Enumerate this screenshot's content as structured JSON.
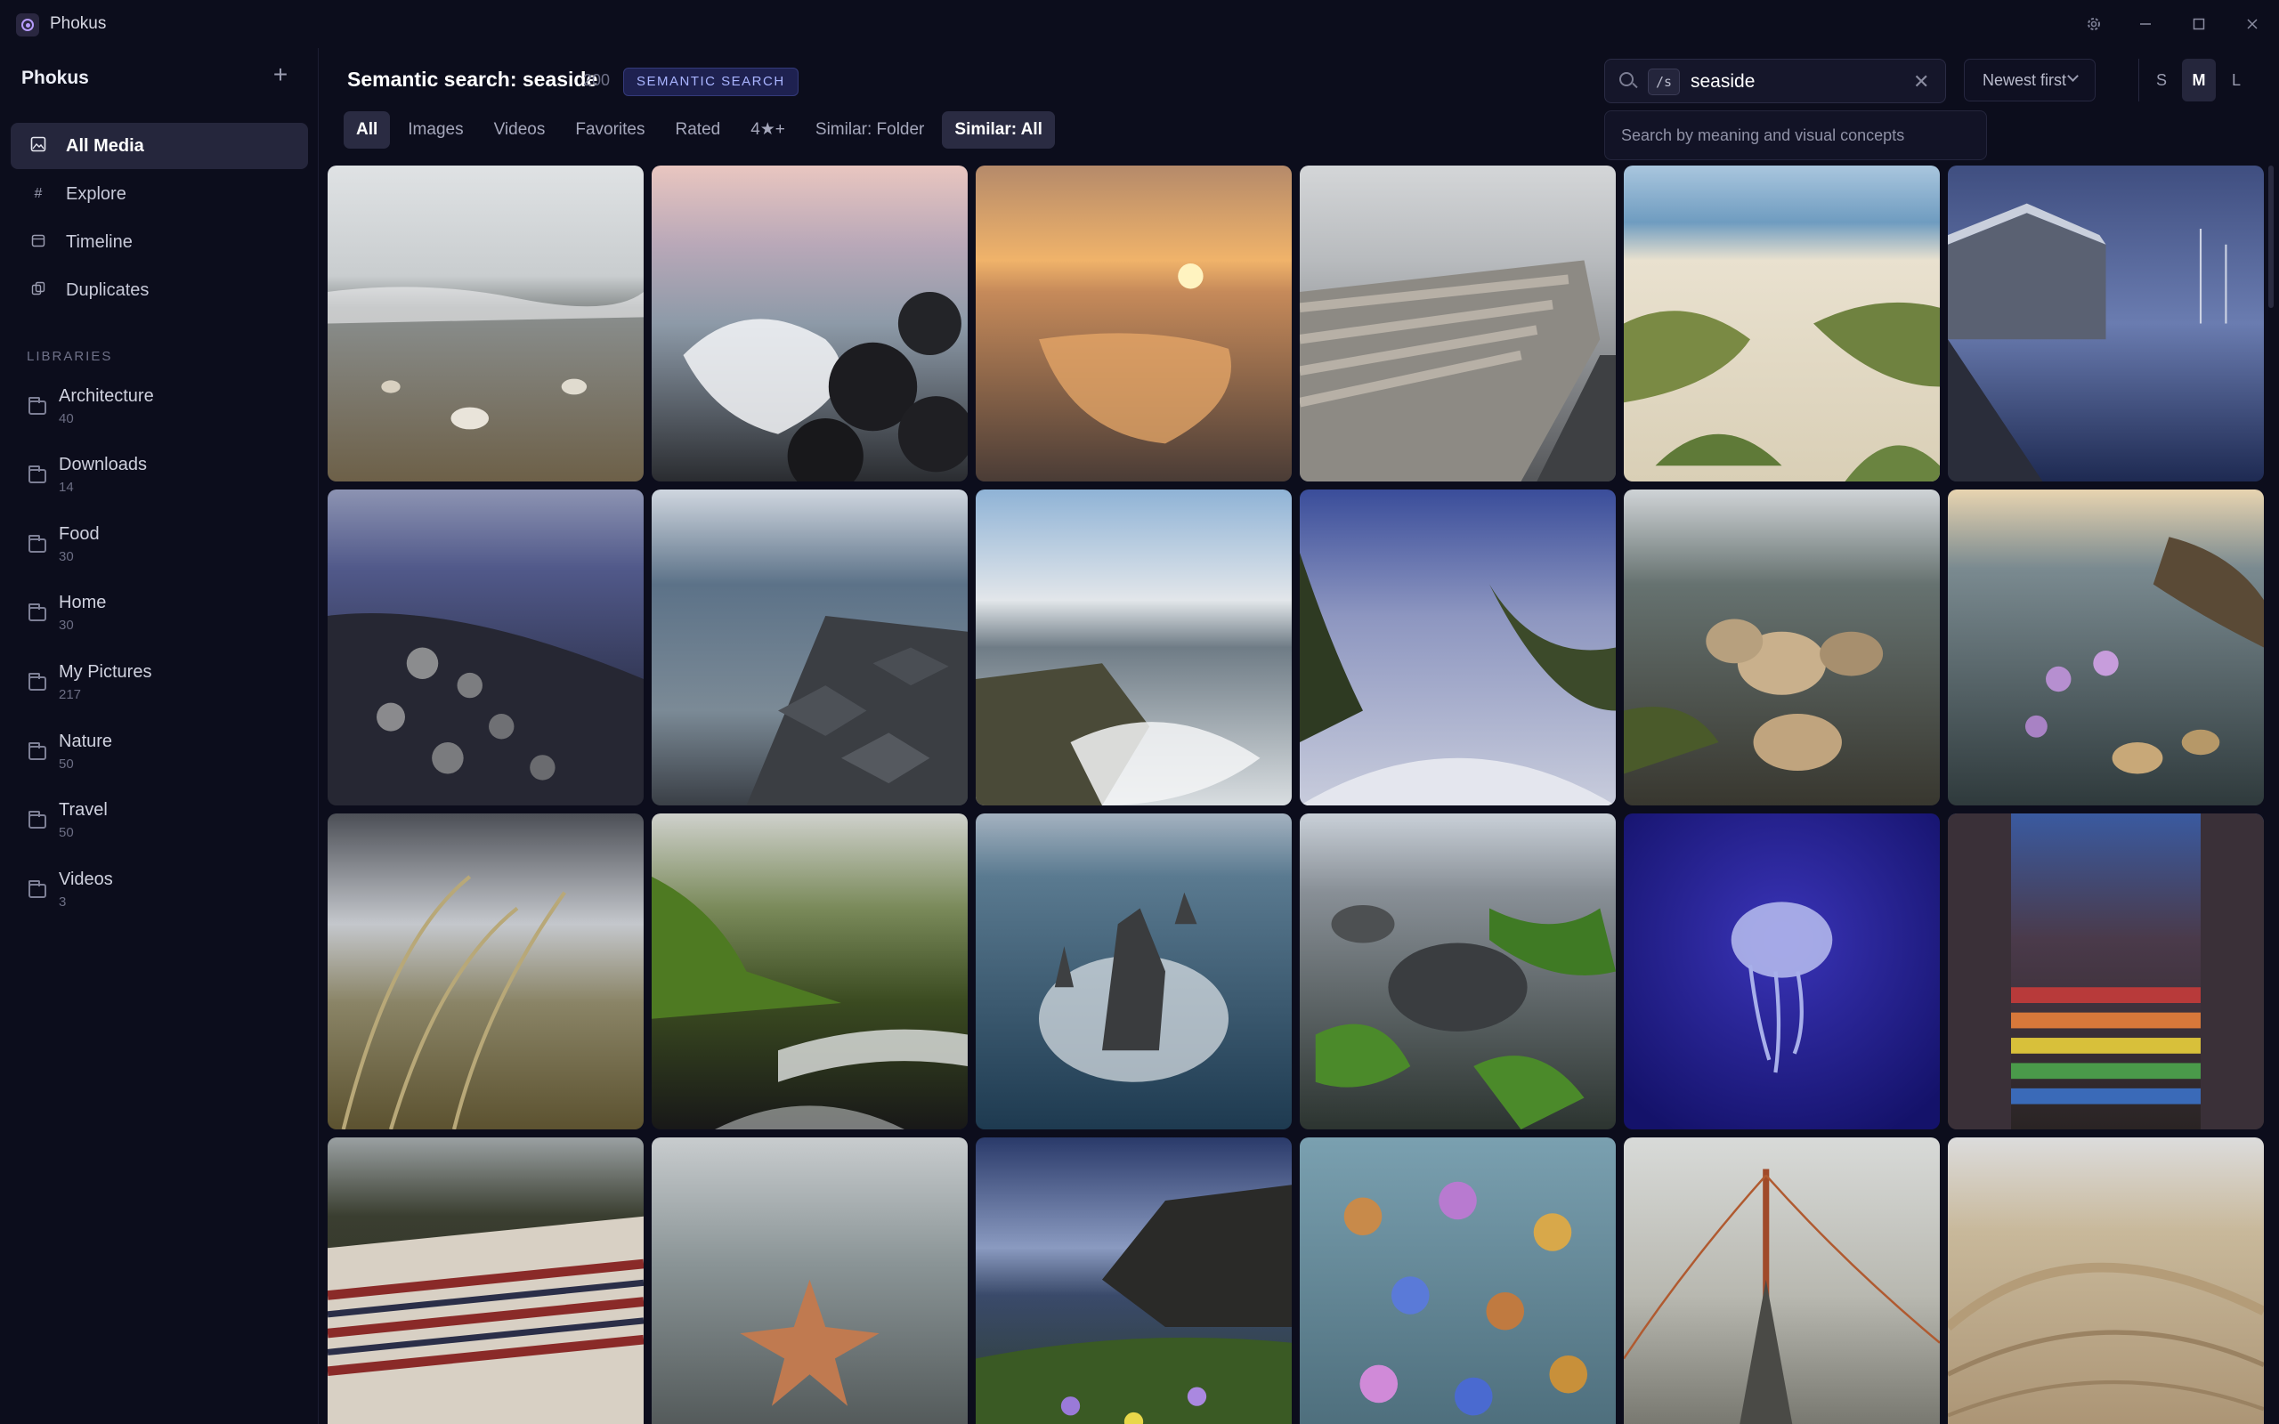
{
  "window": {
    "title": "Phokus"
  },
  "sidebar": {
    "title": "Phokus",
    "nav": [
      {
        "label": "All Media",
        "icon": "image-icon",
        "active": true
      },
      {
        "label": "Explore",
        "icon": "hash-icon"
      },
      {
        "label": "Timeline",
        "icon": "calendar-icon"
      },
      {
        "label": "Duplicates",
        "icon": "duplicate-icon"
      }
    ],
    "libraries_heading": "LIBRARIES",
    "libraries": [
      {
        "name": "Architecture",
        "count": "40"
      },
      {
        "name": "Downloads",
        "count": "14"
      },
      {
        "name": "Food",
        "count": "30"
      },
      {
        "name": "Home",
        "count": "30"
      },
      {
        "name": "My Pictures",
        "count": "217"
      },
      {
        "name": "Nature",
        "count": "50"
      },
      {
        "name": "Travel",
        "count": "50"
      },
      {
        "name": "Videos",
        "count": "3"
      }
    ]
  },
  "header": {
    "title": "Semantic search: seaside",
    "count": "200",
    "badge": "SEMANTIC SEARCH",
    "filters": [
      "All",
      "Images",
      "Videos",
      "Favorites",
      "Rated",
      "4★+",
      "Similar: Folder",
      "Similar: All"
    ],
    "active_filters": [
      "All",
      "Similar: All"
    ]
  },
  "search": {
    "prefix": "/s",
    "value": "seaside",
    "hint": "Search by meaning and visual concepts"
  },
  "sort": {
    "label": "Newest first"
  },
  "sizes": {
    "small": "S",
    "medium": "M",
    "large": "L",
    "active": "M"
  },
  "grid": {
    "items": [
      {
        "name": "beach-shells"
      },
      {
        "name": "waves-rocks"
      },
      {
        "name": "sunset-tidepool"
      },
      {
        "name": "warehouse-roofs"
      },
      {
        "name": "sand-dunes"
      },
      {
        "name": "harbor-boathouse"
      },
      {
        "name": "barnacle-rocks"
      },
      {
        "name": "basalt-coast"
      },
      {
        "name": "cliff-waves"
      },
      {
        "name": "dune-grass"
      },
      {
        "name": "shells-tidepool"
      },
      {
        "name": "anemone-pool"
      },
      {
        "name": "wheat-grass"
      },
      {
        "name": "green-cliffs-beach"
      },
      {
        "name": "sea-stacks"
      },
      {
        "name": "seaweed-stones"
      },
      {
        "name": "jellyfish"
      },
      {
        "name": "rainbow-stairs"
      },
      {
        "name": "woven-blanket"
      },
      {
        "name": "starfish"
      },
      {
        "name": "wildflower-cliffs"
      },
      {
        "name": "anemone-flowers"
      },
      {
        "name": "fog-bridge"
      },
      {
        "name": "desert-dune"
      }
    ]
  }
}
